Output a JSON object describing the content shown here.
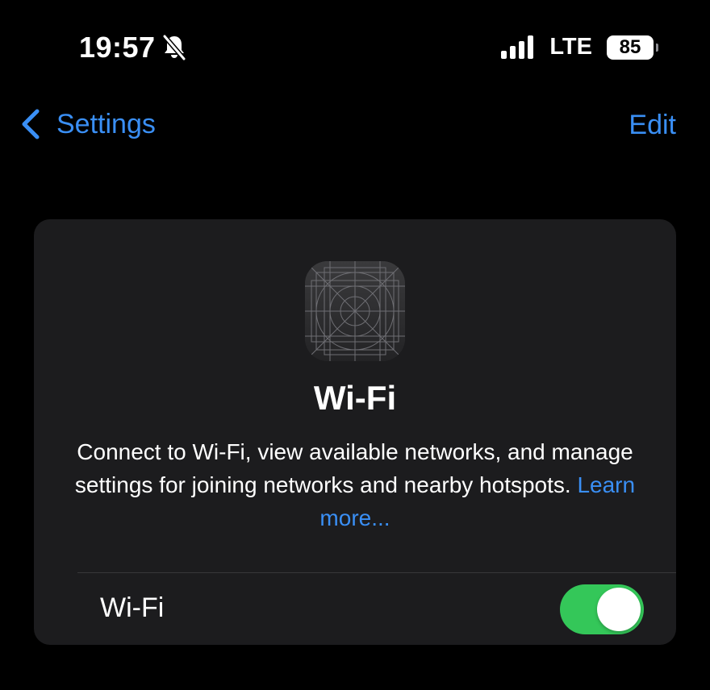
{
  "status_bar": {
    "time": "19:57",
    "silent_icon": "bell-slash-icon",
    "signal_icon": "cellular-signal-icon",
    "network": "LTE",
    "battery_level": "85"
  },
  "nav": {
    "back_icon": "chevron-left-icon",
    "back_label": "Settings",
    "edit_label": "Edit"
  },
  "card": {
    "icon": "app-placeholder-icon",
    "title": "Wi-Fi",
    "description": "Connect to Wi-Fi, view available networks, and manage settings for joining networks and nearby hotspots.",
    "learn_more": "Learn more..."
  },
  "wifi_row": {
    "label": "Wi-Fi",
    "toggle_on": true
  },
  "colors": {
    "background": "#000000",
    "card": "#1c1c1e",
    "accent_blue": "#3a8ff5",
    "toggle_green": "#34c759",
    "divider": "#38383a"
  }
}
